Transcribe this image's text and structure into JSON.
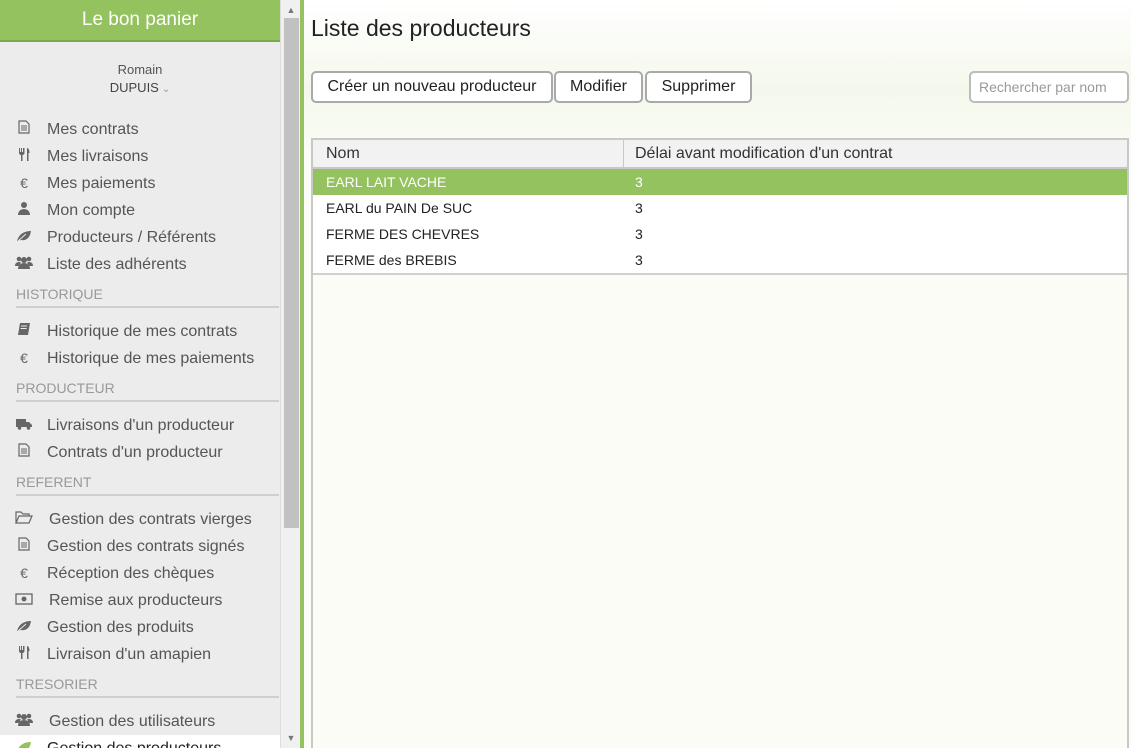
{
  "app": {
    "title": "Le bon panier"
  },
  "user": {
    "first_name": "Romain",
    "last_name": "DUPUIS",
    "chevron": "chevron-down-icon"
  },
  "menu": {
    "main": [
      {
        "label": "Mes contrats",
        "icon": "document-icon"
      },
      {
        "label": "Mes livraisons",
        "icon": "cutlery-icon"
      },
      {
        "label": "Mes paiements",
        "icon": "euro-icon"
      },
      {
        "label": "Mon compte",
        "icon": "user-icon"
      },
      {
        "label": "Producteurs / Référents",
        "icon": "leaf-icon"
      },
      {
        "label": "Liste des adhérents",
        "icon": "users-icon"
      }
    ],
    "historique": {
      "title": "HISTORIQUE",
      "items": [
        {
          "label": "Historique de mes contrats",
          "icon": "book-icon"
        },
        {
          "label": "Historique de mes paiements",
          "icon": "euro-icon"
        }
      ]
    },
    "producteur": {
      "title": "PRODUCTEUR",
      "items": [
        {
          "label": "Livraisons d'un producteur",
          "icon": "truck-icon"
        },
        {
          "label": "Contrats d'un producteur",
          "icon": "document-icon"
        }
      ]
    },
    "referent": {
      "title": "REFERENT",
      "items": [
        {
          "label": "Gestion des contrats vierges",
          "icon": "folder-open-icon"
        },
        {
          "label": "Gestion des contrats signés",
          "icon": "document-icon"
        },
        {
          "label": "Réception des chèques",
          "icon": "euro-icon"
        },
        {
          "label": "Remise aux producteurs",
          "icon": "money-icon"
        },
        {
          "label": "Gestion des produits",
          "icon": "leaf-icon"
        },
        {
          "label": "Livraison d'un amapien",
          "icon": "cutlery-icon"
        }
      ]
    },
    "tresorier": {
      "title": "TRESORIER",
      "items": [
        {
          "label": "Gestion des utilisateurs",
          "icon": "users-icon"
        },
        {
          "label": "Gestion des producteurs",
          "icon": "leaf-icon",
          "active": true
        }
      ]
    }
  },
  "page": {
    "title": "Liste des producteurs",
    "buttons": {
      "create": "Créer un nouveau producteur",
      "modify": "Modifier",
      "delete": "Supprimer"
    },
    "search": {
      "placeholder": "Rechercher par nom",
      "value": ""
    }
  },
  "table": {
    "columns": [
      "Nom",
      "Délai avant modification d'un contrat"
    ],
    "rows": [
      {
        "name": "EARL LAIT VACHE",
        "delay": "3",
        "selected": true
      },
      {
        "name": "EARL du PAIN De SUC",
        "delay": "3"
      },
      {
        "name": "FERME DES CHEVRES",
        "delay": "3"
      },
      {
        "name": "FERME des BREBIS",
        "delay": "3"
      }
    ]
  },
  "colors": {
    "accent": "#93c25f",
    "sidebar_bg": "#ececec"
  }
}
